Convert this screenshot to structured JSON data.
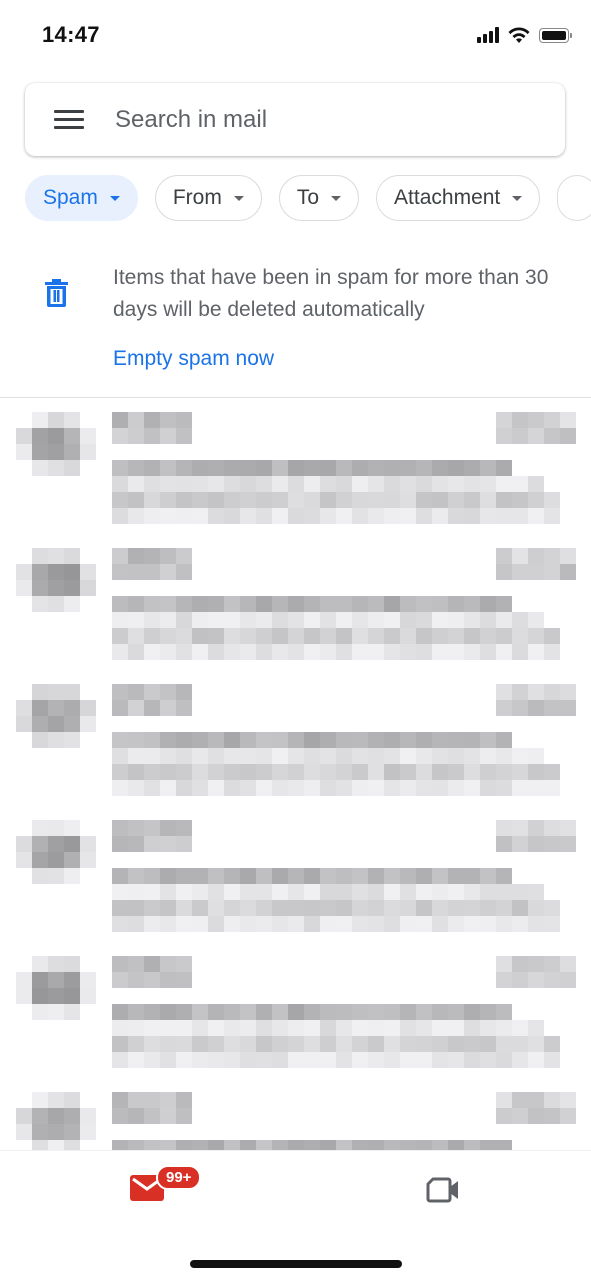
{
  "status_bar": {
    "time": "14:47",
    "icons": [
      "signal-icon",
      "wifi-icon",
      "battery-icon"
    ]
  },
  "search": {
    "placeholder": "Search in mail",
    "menu_icon": "hamburger-menu-icon"
  },
  "filter_chips": [
    {
      "label": "Spam",
      "active": true
    },
    {
      "label": "From",
      "active": false
    },
    {
      "label": "To",
      "active": false
    },
    {
      "label": "Attachment",
      "active": false
    }
  ],
  "spam_notice": {
    "icon": "trash-icon",
    "text": "Items that have been in spam for more than 30 days will be deleted automatically",
    "action_label": "Empty spam now"
  },
  "mail_list": {
    "redacted": true,
    "row_count": 6
  },
  "bottom_nav": {
    "mail_icon": "mail-icon",
    "mail_badge": "99+",
    "meet_icon": "video-camera-icon"
  },
  "colors": {
    "accent": "#1a73e8",
    "chip_active_bg": "#e8f0fe",
    "badge": "#d93025",
    "text_secondary": "#5f6368"
  }
}
